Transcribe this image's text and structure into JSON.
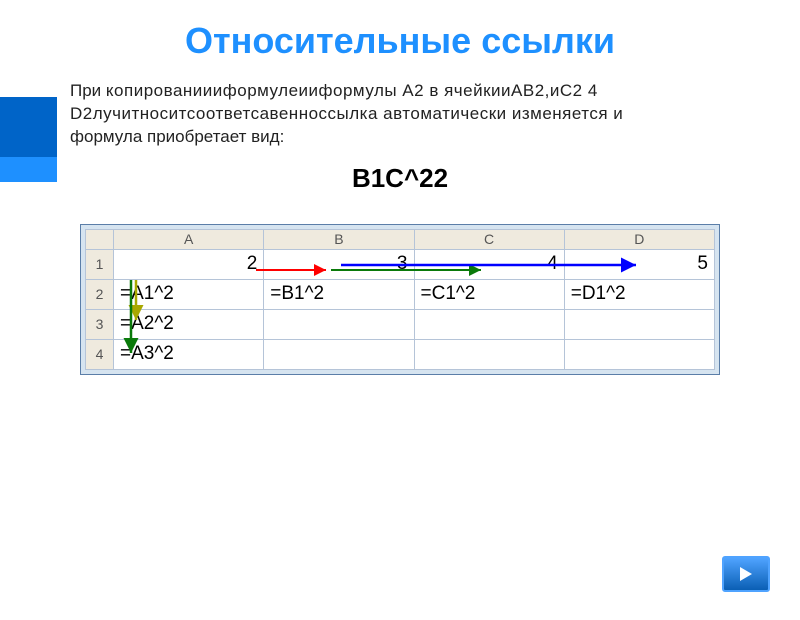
{
  "title": "Относительные ссылки",
  "paragraph": {
    "line1_prefix": "При ",
    "line1_garbled": "копированиииформулеииформулы А2 в ячейкииАВ2,иС2 4",
    "line2": "D2лучитноситсоответсавенноссылка автоматически изменяется и",
    "line3": "формула приобретает вид:"
  },
  "big_formula": "В1С^22",
  "sheet": {
    "columns": [
      "A",
      "B",
      "C",
      "D"
    ],
    "rows": [
      "1",
      "2",
      "3",
      "4"
    ],
    "cells": {
      "A1": "2",
      "B1": "3",
      "C1": "4",
      "D1": "5",
      "A2": "=A1^2",
      "B2": "=B1^2",
      "C2": "=C1^2",
      "D2": "=D1^2",
      "A3": "=A2^2",
      "A4": "=A3^2"
    }
  },
  "nav": {
    "next": "▶"
  }
}
